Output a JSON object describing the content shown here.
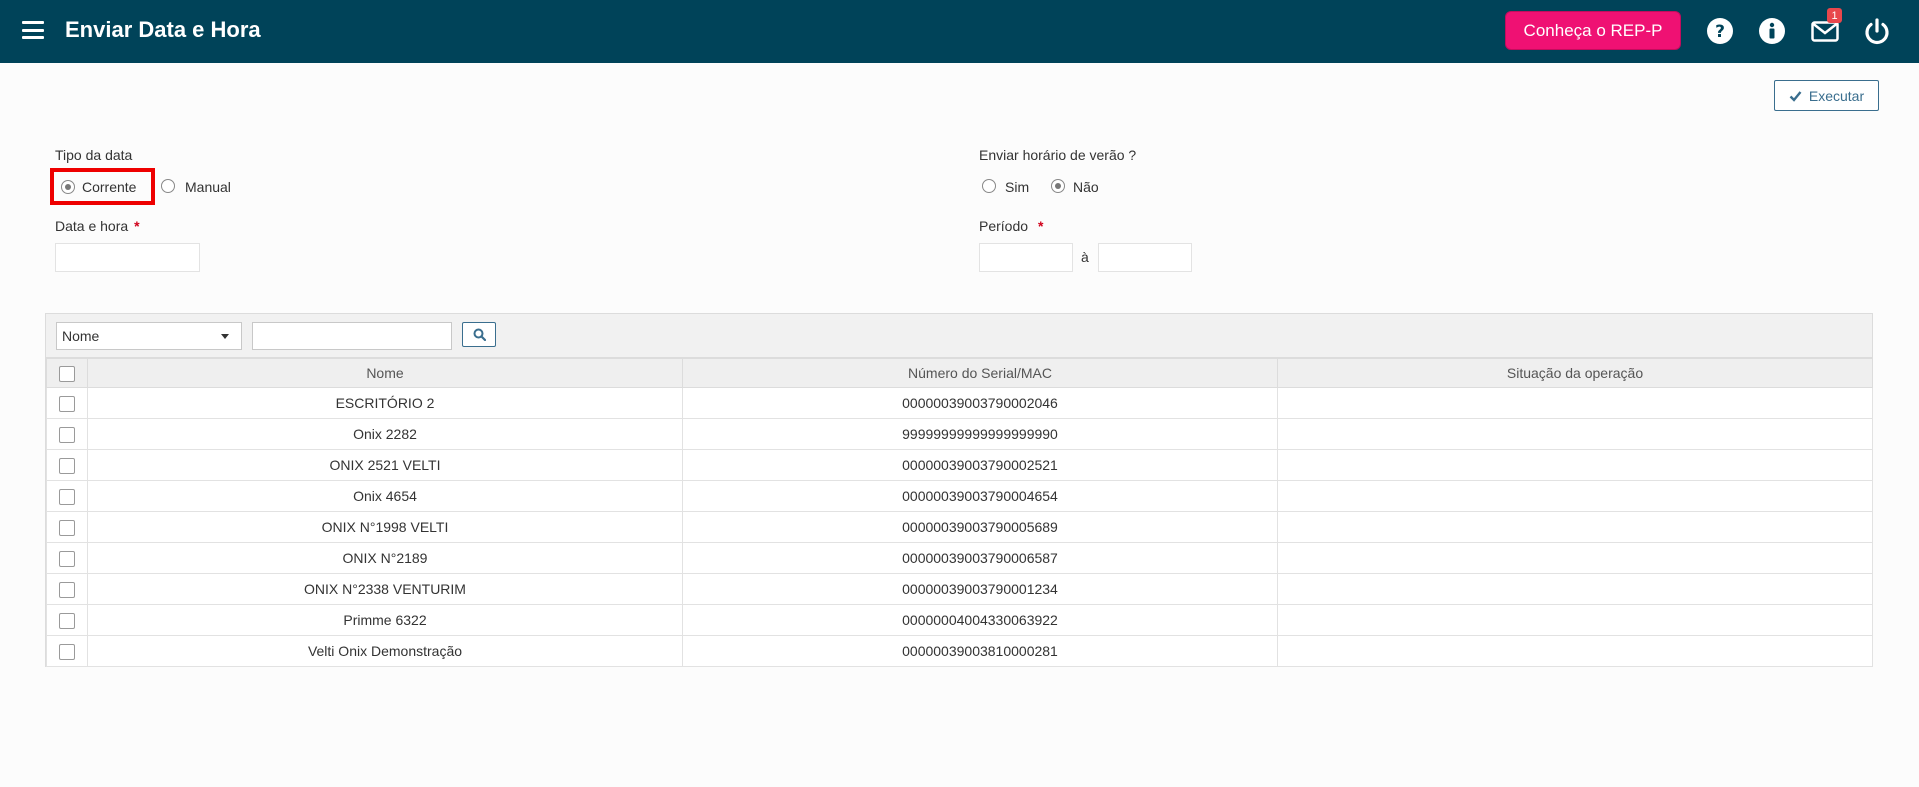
{
  "header": {
    "title": "Enviar Data e Hora",
    "cta_label": "Conheça o REP-P",
    "notification_count": "1",
    "icons": [
      "menu-icon",
      "help-icon",
      "info-icon",
      "mail-icon",
      "power-icon"
    ]
  },
  "actions": {
    "execute_label": "Executar"
  },
  "form": {
    "tipo_data_label": "Tipo da data",
    "tipo_data_options": [
      "Corrente",
      "Manual"
    ],
    "tipo_data_selected": "Corrente",
    "data_hora_label": "Data e hora",
    "required_mark": "*",
    "horario_verao_label": "Enviar horário de verão ?",
    "horario_verao_options": [
      "Sim",
      "Não"
    ],
    "horario_verao_selected": "Não",
    "periodo_label": "Período",
    "periodo_separator": "à"
  },
  "filter": {
    "field_selected": "Nome"
  },
  "table": {
    "columns": [
      "Nome",
      "Número do Serial/MAC",
      "Situação da operação"
    ],
    "rows": [
      {
        "nome": "ESCRITÓRIO 2",
        "serial": "00000039003790002046",
        "situacao": ""
      },
      {
        "nome": "Onix 2282",
        "serial": "99999999999999999990",
        "situacao": ""
      },
      {
        "nome": "ONIX 2521 VELTI",
        "serial": "00000039003790002521",
        "situacao": ""
      },
      {
        "nome": "Onix 4654",
        "serial": "00000039003790004654",
        "situacao": ""
      },
      {
        "nome": "ONIX N°1998 VELTI",
        "serial": "00000039003790005689",
        "situacao": ""
      },
      {
        "nome": "ONIX N°2189",
        "serial": "00000039003790006587",
        "situacao": ""
      },
      {
        "nome": "ONIX N°2338 VENTURIM",
        "serial": "00000039003790001234",
        "situacao": ""
      },
      {
        "nome": "Primme 6322",
        "serial": "00000004004330063922",
        "situacao": ""
      },
      {
        "nome": "Velti Onix Demonstração",
        "serial": "00000039003810000281",
        "situacao": ""
      }
    ]
  },
  "colors": {
    "topbar": "#004359",
    "cta": "#ef1173",
    "accent": "#3a6e8e",
    "highlight": "#ee0000"
  }
}
